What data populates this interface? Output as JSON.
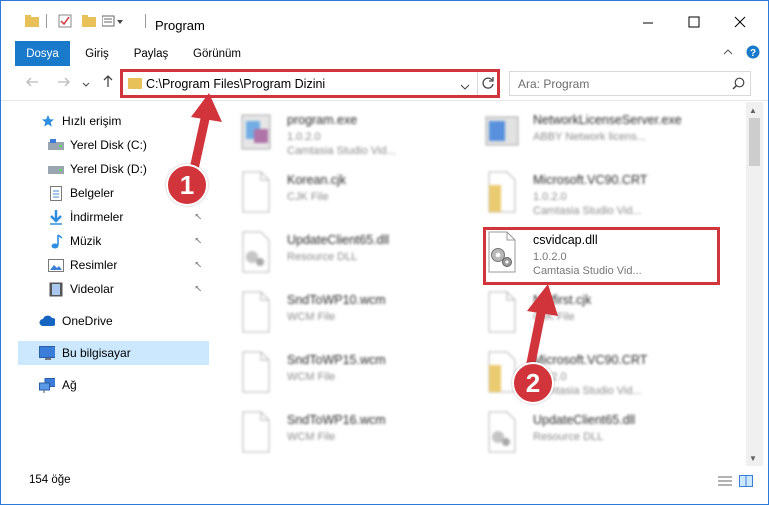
{
  "window": {
    "title": "Program",
    "controls": [
      "minimize-icon",
      "maximize-icon",
      "close-icon"
    ]
  },
  "ribbon": {
    "tabs": [
      {
        "label": "Dosya",
        "active": true
      },
      {
        "label": "Giriş",
        "active": false
      },
      {
        "label": "Paylaş",
        "active": false
      },
      {
        "label": "Görünüm",
        "active": false
      }
    ]
  },
  "address": {
    "path": "C:\\Program Files\\Program Dizini",
    "search_placeholder": "Ara: Program"
  },
  "nav": {
    "items": [
      {
        "label": "Hızlı erişim",
        "icon": "star-icon"
      },
      {
        "label": "Yerel Disk (C:)",
        "icon": "drive-icon"
      },
      {
        "label": "Yerel Disk (D:)",
        "icon": "drive-icon"
      },
      {
        "label": "Belgeler",
        "icon": "documents-icon"
      },
      {
        "label": "İndirmeler",
        "icon": "download-icon"
      },
      {
        "label": "Müzik",
        "icon": "music-icon"
      },
      {
        "label": "Resimler",
        "icon": "pictures-icon"
      },
      {
        "label": "Videolar",
        "icon": "video-icon"
      },
      {
        "label": "OneDrive",
        "icon": "cloud-icon"
      },
      {
        "label": "Bu bilgisayar",
        "icon": "computer-icon"
      },
      {
        "label": "Ağ",
        "icon": "network-icon"
      }
    ]
  },
  "files": {
    "left": [
      {
        "name": "program.exe",
        "sub1": "1.0.2.0",
        "sub2": "Camtasia Studio Vid..."
      },
      {
        "name": "Korean.cjk",
        "sub1": "CJK File",
        "sub2": ""
      },
      {
        "name": "UpdateClient65.dll",
        "sub1": "Resource DLL",
        "sub2": ""
      },
      {
        "name": "SndToWP10.wcm",
        "sub1": "WCM File",
        "sub2": ""
      },
      {
        "name": "SndToWP15.wcm",
        "sub1": "WCM File",
        "sub2": ""
      },
      {
        "name": "SndToWP16.wcm",
        "sub1": "WCM File",
        "sub2": ""
      }
    ],
    "right": [
      {
        "name": "NetworkLicenseServer.exe",
        "sub1": "ABBY Network licens...",
        "sub2": ""
      },
      {
        "name": "Microsoft.VC90.CRT",
        "sub1": "1.0.2.0",
        "sub2": "Camtasia Studio Vid..."
      },
      {
        "name": "csvidcap.dll",
        "sub1": "1.0.2.0",
        "sub2": "Camtasia Studio Vid..."
      },
      {
        "name": "Netfirst.cjk",
        "sub1": "CJK File",
        "sub2": ""
      },
      {
        "name": "Microsoft.VC90.CRT",
        "sub1": "1.0.2.0",
        "sub2": "Camtasia Studio Vid..."
      },
      {
        "name": "UpdateClient65.dll",
        "sub1": "Resource DLL",
        "sub2": ""
      }
    ]
  },
  "status": {
    "count": "154 öğe"
  },
  "annotations": {
    "badge1": "1",
    "badge2": "2",
    "color": "#d1343b"
  }
}
